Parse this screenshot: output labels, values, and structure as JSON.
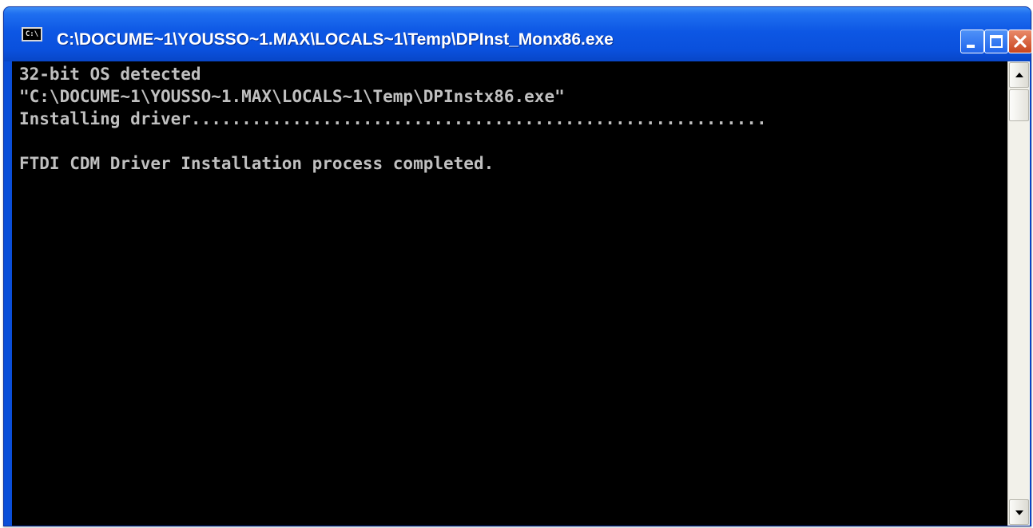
{
  "window": {
    "title": "C:\\DOCUME~1\\YOUSSO~1.MAX\\LOCALS~1\\Temp\\DPInst_Monx86.exe",
    "app_icon_text": "C:\\",
    "app_icon": "console-window-icon",
    "controls": {
      "minimize_icon": "minimize-icon",
      "maximize_icon": "maximize-icon",
      "close_icon": "close-icon"
    }
  },
  "console": {
    "lines": [
      "32-bit OS detected",
      "\"C:\\DOCUME~1\\YOUSSO~1.MAX\\LOCALS~1\\Temp\\DPInstx86.exe\"",
      "Installing driver.........................................................",
      "",
      "FTDI CDM Driver Installation process completed."
    ]
  },
  "scrollbar": {
    "up_icon": "scroll-up-arrow-icon",
    "down_icon": "scroll-down-arrow-icon"
  },
  "colors": {
    "titlebar": "#0a50dc",
    "console_background": "#000000",
    "console_text": "#c0c0c0",
    "close_button": "#c8451e"
  }
}
